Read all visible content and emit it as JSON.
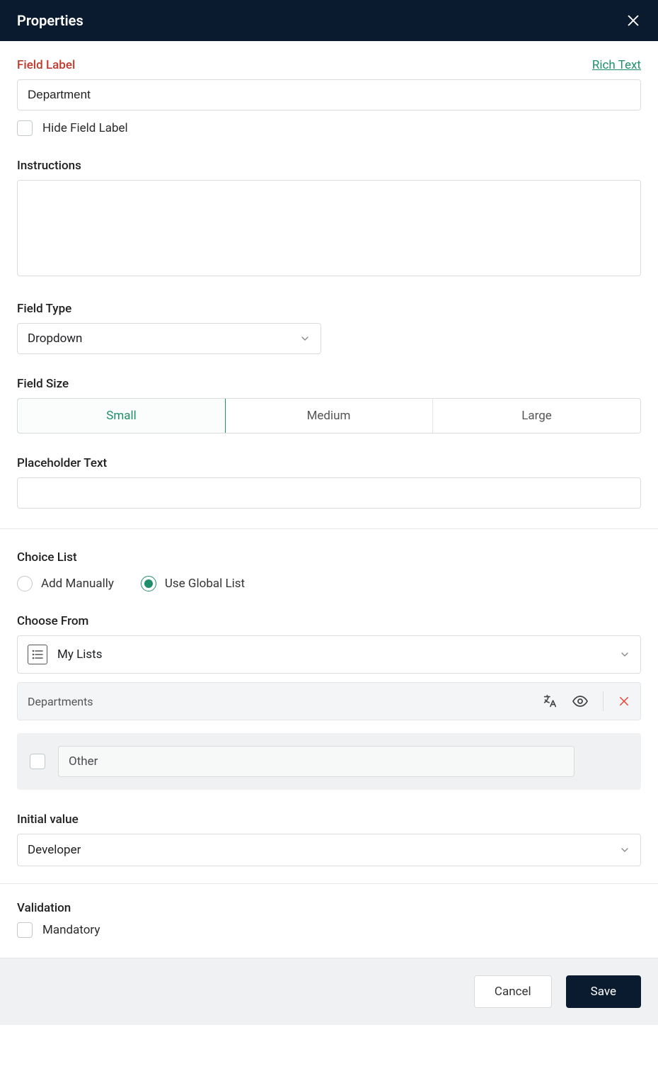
{
  "header": {
    "title": "Properties"
  },
  "field_label": {
    "label": "Field Label",
    "rich_text_link": "Rich Text",
    "value": "Department",
    "hide_label": "Hide Field Label"
  },
  "instructions": {
    "label": "Instructions",
    "value": ""
  },
  "field_type": {
    "label": "Field Type",
    "value": "Dropdown"
  },
  "field_size": {
    "label": "Field Size",
    "options": {
      "small": "Small",
      "medium": "Medium",
      "large": "Large"
    }
  },
  "placeholder": {
    "label": "Placeholder Text",
    "value": ""
  },
  "choice_list": {
    "label": "Choice List",
    "add_manually": "Add Manually",
    "use_global": "Use Global List"
  },
  "choose_from": {
    "label": "Choose From",
    "value": "My Lists",
    "selected_list": "Departments",
    "other_label": "Other"
  },
  "initial_value": {
    "label": "Initial value",
    "value": "Developer"
  },
  "validation": {
    "label": "Validation",
    "mandatory": "Mandatory"
  },
  "footer": {
    "cancel": "Cancel",
    "save": "Save"
  }
}
